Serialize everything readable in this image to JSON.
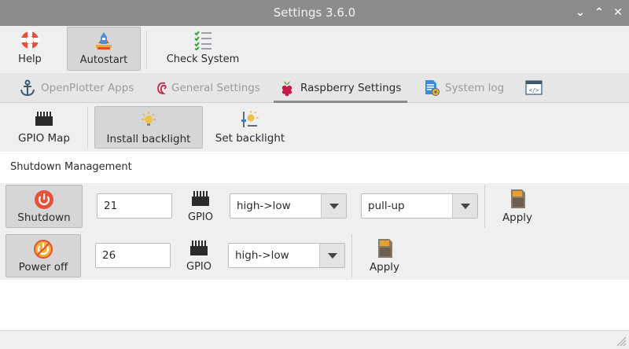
{
  "window": {
    "title": "Settings 3.6.0"
  },
  "toolbar": {
    "items": [
      {
        "label": "Help",
        "icon": "help-lifebuoy-icon"
      },
      {
        "label": "Autostart",
        "icon": "rocket-icon",
        "active": true
      },
      {
        "label": "Check System",
        "icon": "checklist-icon"
      }
    ]
  },
  "tabs": [
    {
      "label": "OpenPlotter Apps",
      "icon": "anchor-icon"
    },
    {
      "label": "General Settings",
      "icon": "debian-swirl-icon"
    },
    {
      "label": "Raspberry Settings",
      "icon": "raspberry-icon",
      "active": true
    },
    {
      "label": "System log",
      "icon": "log-gear-icon"
    },
    {
      "label": "",
      "icon": "code-window-icon"
    }
  ],
  "subtoolbar": {
    "items": [
      {
        "label": "GPIO Map",
        "icon": "gpio-chip-icon"
      },
      {
        "label": "Install backlight",
        "icon": "backlight-bulb-icon",
        "active": true
      },
      {
        "label": "Set backlight",
        "icon": "backlight-slider-icon"
      }
    ]
  },
  "section": {
    "title": "Shutdown Management"
  },
  "rows": [
    {
      "button": "Shutdown",
      "pin": "21",
      "gpio": "GPIO",
      "edge": "high->low",
      "pull": "pull-up",
      "apply": "Apply"
    },
    {
      "button": "Power off",
      "pin": "26",
      "gpio": "GPIO",
      "edge": "high->low",
      "apply": "Apply"
    }
  ],
  "colors": {
    "titlebar": "#8c8c8c",
    "accent_red": "#e8503a",
    "raspberry": "#c51a4a"
  }
}
